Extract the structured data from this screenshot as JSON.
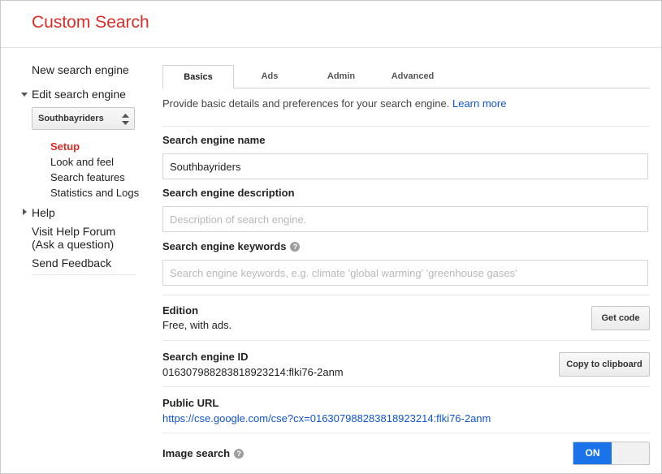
{
  "app": {
    "title": "Custom Search"
  },
  "sidebar": {
    "new_engine": "New search engine",
    "edit_engine": "Edit search engine",
    "selected_engine": "Southbayriders",
    "sub_items": [
      {
        "label": "Setup",
        "active": true
      },
      {
        "label": "Look and feel"
      },
      {
        "label": "Search features"
      },
      {
        "label": "Statistics and Logs"
      }
    ],
    "help": "Help",
    "forum_line1": "Visit Help Forum",
    "forum_line2": "(Ask a question)",
    "feedback": "Send Feedback"
  },
  "tabs": [
    {
      "label": "Basics",
      "active": true
    },
    {
      "label": "Ads"
    },
    {
      "label": "Admin"
    },
    {
      "label": "Advanced"
    }
  ],
  "intro": {
    "text": "Provide basic details and preferences for your search engine. ",
    "link": "Learn more"
  },
  "fields": {
    "name_label": "Search engine name",
    "name_value": "Southbayriders",
    "description_label": "Search engine description",
    "description_placeholder": "Description of search engine.",
    "keywords_label": "Search engine keywords",
    "keywords_placeholder": "Search engine keywords, e.g. climate 'global warming' 'greenhouse gases'",
    "help_glyph": "?"
  },
  "edition": {
    "label": "Edition",
    "value": "Free, with ads.",
    "button": "Get code"
  },
  "engine_id": {
    "label": "Search engine ID",
    "value": "016307988283818923214:flki76-2anm",
    "button": "Copy to clipboard"
  },
  "public_url": {
    "label": "Public URL",
    "value": "https://cse.google.com/cse?cx=016307988283818923214:flki76-2anm"
  },
  "image_search": {
    "label": "Image search",
    "toggle": "ON",
    "enabled": true
  },
  "colors": {
    "brand": "#dd2c26",
    "link": "#1155cc",
    "toggle_on": "#1a73e8"
  },
  "icons": [
    "updown-arrows-icon",
    "triangle-down-icon",
    "triangle-right-icon",
    "help-icon"
  ]
}
